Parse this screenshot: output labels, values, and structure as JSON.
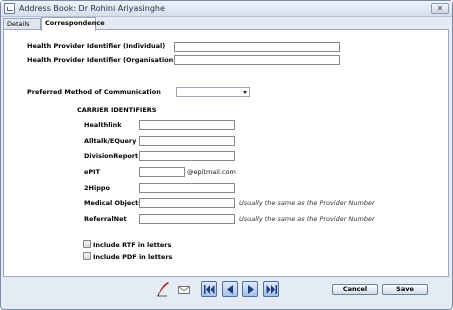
{
  "window": {
    "title": "Address Book: Dr Rohini Ariyasinghe",
    "close_icon": "close-icon",
    "app_icon": "address-book-icon"
  },
  "tabs": [
    {
      "label": "Details",
      "active": false
    },
    {
      "label": "Correspondence",
      "active": true
    }
  ],
  "provider": {
    "individual_label": "Health Provider Identifier (Individual)",
    "individual_value": "",
    "organisation_label": "Health Provider Identifier (Organisation)",
    "organisation_value": ""
  },
  "communication": {
    "label": "Preferred Method of Communication",
    "selected": ""
  },
  "carriers": {
    "heading": "CARRIER IDENTIFIERS",
    "items": [
      {
        "label": "Healthlink",
        "value": "",
        "hint": ""
      },
      {
        "label": "Alltalk/EQuery",
        "value": "",
        "hint": ""
      },
      {
        "label": "DivisionReport",
        "value": "",
        "hint": ""
      },
      {
        "label": "ePIT",
        "value": "",
        "suffix": "@epitmail.com"
      },
      {
        "label": "2Hippo",
        "value": "",
        "hint": ""
      },
      {
        "label": "Medical Objects",
        "value": "",
        "hint": "Usually the same as the Provider Number"
      },
      {
        "label": "ReferralNet",
        "value": "",
        "hint": "Usually the same as the Provider Number"
      }
    ]
  },
  "options": {
    "include_rtf": {
      "label": "Include RTF in letters",
      "checked": false
    },
    "include_pdf": {
      "label": "Include PDF in letters",
      "checked": false
    }
  },
  "footer": {
    "cancel_label": "Cancel",
    "save_label": "Save",
    "icons": [
      "quill-pen-icon",
      "envelope-icon",
      "first-record-icon",
      "previous-record-icon",
      "next-record-icon",
      "last-record-icon"
    ]
  },
  "colors": {
    "window_bg": "#e4ebf5",
    "nav_button": "#a9c0e6",
    "border": "#9ba9bf"
  }
}
